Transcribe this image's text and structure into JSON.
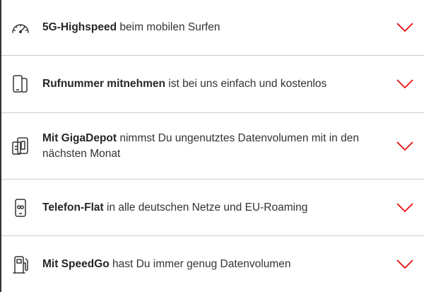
{
  "colors": {
    "accent": "#e60000",
    "text": "#333333",
    "divider": "#cccccc"
  },
  "items": [
    {
      "icon": "speedometer-icon",
      "bold": "5G-Highspeed",
      "rest": " beim mobilen Surfen"
    },
    {
      "icon": "phone-transfer-icon",
      "bold": "Rufnummer mitnehmen",
      "rest": " ist bei uns einfach und kostenlos"
    },
    {
      "icon": "data-depot-icon",
      "bold": "Mit GigaDepot",
      "rest": " nimmst Du ungenutztes Datenvolumen mit in den nächsten Monat"
    },
    {
      "icon": "phone-flat-icon",
      "bold": "Telefon-Flat",
      "rest": " in alle deutschen Netze und EU-Roaming"
    },
    {
      "icon": "fuel-pump-icon",
      "bold": "Mit SpeedGo",
      "rest": " hast Du immer genug Datenvolumen"
    }
  ]
}
